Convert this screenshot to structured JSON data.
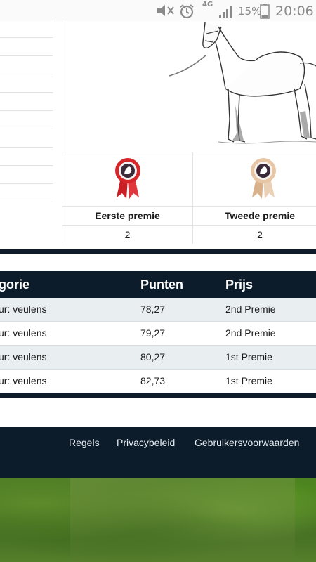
{
  "status_bar": {
    "network": "4G",
    "battery": "15%",
    "time": "20:06",
    "icons": [
      "mute-icon",
      "alarm-icon",
      "signal-icon",
      "battery-icon"
    ]
  },
  "awards": [
    {
      "label": "Eerste premie",
      "count": "2",
      "ribbon_color": "#d6262a",
      "icon": "red-rosette-icon"
    },
    {
      "label": "Tweede premie",
      "count": "2",
      "ribbon_color": "#e7c6a6",
      "icon": "beige-rosette-icon"
    }
  ],
  "results": {
    "headers": [
      "gorie",
      "Punten",
      "Prijs"
    ],
    "rows": [
      {
        "category": "ur: veulens",
        "points": "78,27",
        "prize": "2nd Premie"
      },
      {
        "category": "ur: veulens",
        "points": "79,27",
        "prize": "2nd Premie"
      },
      {
        "category": "ur: veulens",
        "points": "80,27",
        "prize": "1st Premie"
      },
      {
        "category": "ur: veulens",
        "points": "82,73",
        "prize": "1st Premie"
      }
    ]
  },
  "footer": {
    "links": [
      "Regels",
      "Privacybeleid",
      "Gebruikersvoorwaarden"
    ]
  },
  "colors": {
    "navy": "#0c1c2b",
    "row_alt": "#e9eef1"
  }
}
